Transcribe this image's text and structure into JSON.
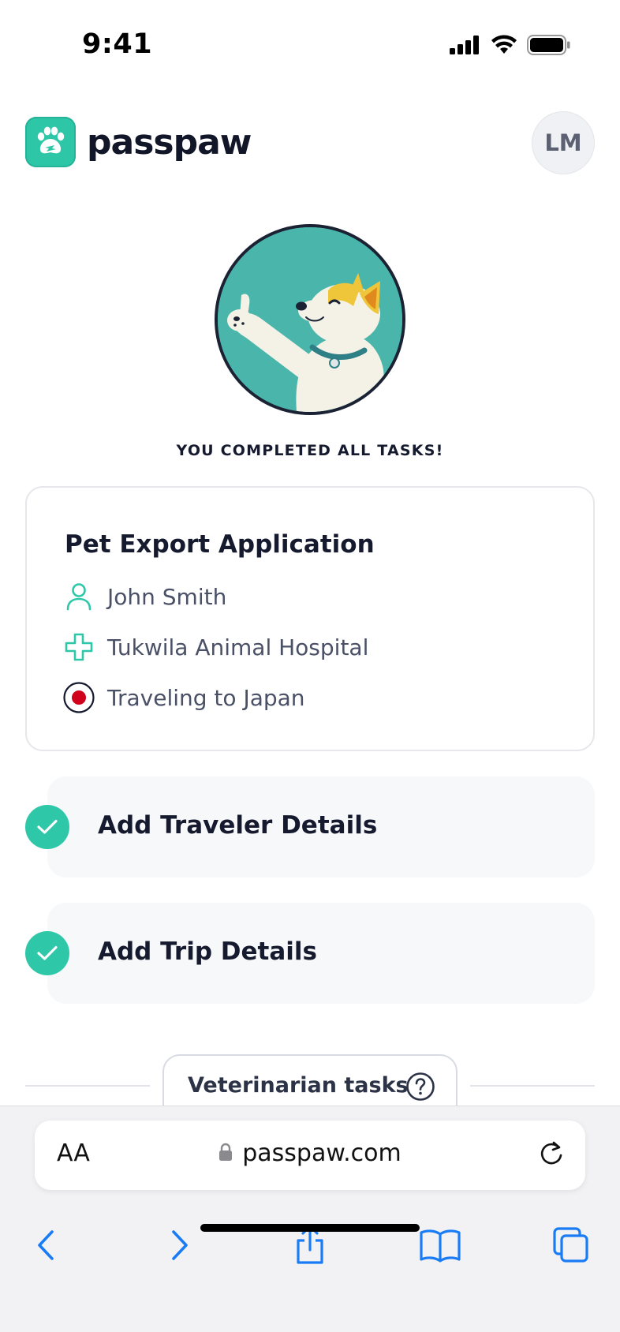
{
  "status_bar": {
    "time": "9:41"
  },
  "header": {
    "brand": "passpaw",
    "avatar_initials": "LM"
  },
  "hero": {
    "caption": "YOU COMPLETED ALL TASKS!"
  },
  "application": {
    "title": "Pet Export Application",
    "traveler": "John Smith",
    "clinic": "Tukwila Animal Hospital",
    "destination": "Traveling to Japan"
  },
  "tasks": [
    {
      "label": "Add Traveler Details",
      "done": true
    },
    {
      "label": "Add Trip Details",
      "done": true
    }
  ],
  "vet_section": {
    "label": "Veterinarian tasks"
  },
  "browser": {
    "text_size_label": "AA",
    "url": "passpaw.com"
  },
  "colors": {
    "brand_teal": "#2dc7a7",
    "check_teal": "#2ec8a8",
    "text_dark": "#151a2e",
    "ios_blue": "#1a7cf5",
    "japan_red": "#d0021b"
  },
  "icons": [
    "signal-icon",
    "wifi-icon",
    "battery-icon",
    "paw-logo-icon",
    "person-icon",
    "medical-cross-icon",
    "japan-flag-icon",
    "checkmark-icon",
    "help-icon",
    "lock-icon",
    "reload-icon",
    "back-icon",
    "forward-icon",
    "share-icon",
    "bookmarks-icon",
    "tabs-icon"
  ]
}
